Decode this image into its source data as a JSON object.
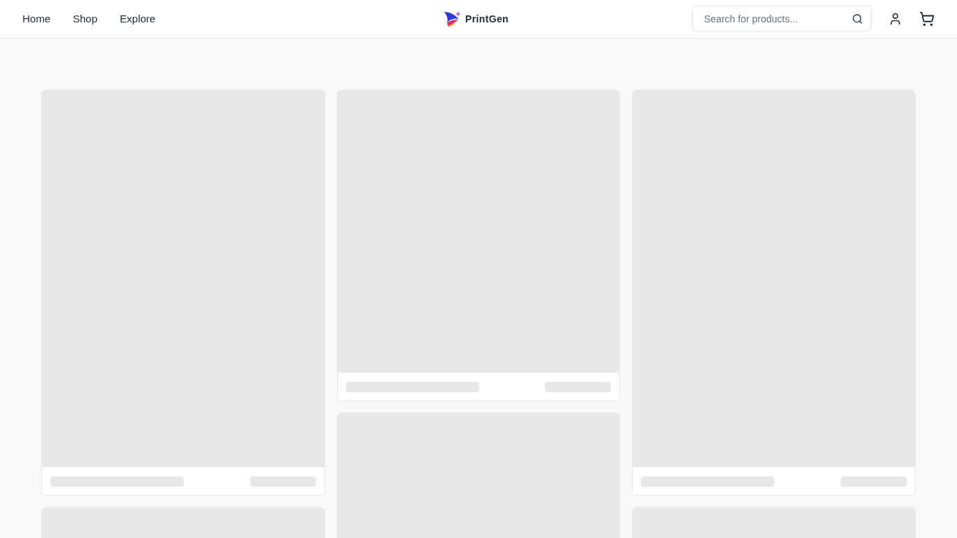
{
  "nav": [
    {
      "label": "Home"
    },
    {
      "label": "Shop"
    },
    {
      "label": "Explore"
    }
  ],
  "logo": {
    "text": "PrintGen"
  },
  "search": {
    "placeholder": "Search for products..."
  },
  "columns": [
    [
      {
        "kind": "tall"
      },
      {
        "kind": "tall"
      }
    ],
    [
      {
        "kind": "short"
      },
      {
        "kind": "tall"
      }
    ],
    [
      {
        "kind": "tall"
      },
      {
        "kind": "tall"
      }
    ]
  ]
}
